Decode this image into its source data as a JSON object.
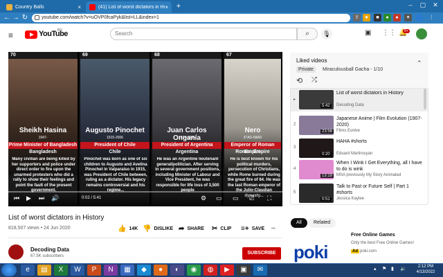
{
  "browser": {
    "tabs": [
      {
        "label": "Country Balls",
        "active": false
      },
      {
        "label": "(41) List of worst dictators in His",
        "active": true
      }
    ],
    "new_tab": "+",
    "url": "youtube.com/watch?v=uOVP0fcaPyk&list=LL&index=1",
    "notif_badge": "9+"
  },
  "youtube": {
    "logo_text": "YouTube",
    "logo_region": "BD",
    "search_placeholder": "Search"
  },
  "video": {
    "cards": [
      {
        "rank": "70",
        "name": "Sheikh Hasina",
        "years": "1947-",
        "title": "Prime Minister of Bangladesh",
        "country": "Bangladesh",
        "desc": "Many civilian are being killed by her supporters and police under direct order to fire upon the unarmed protesters who did a rally to show their feelings and point the fault of the present government."
      },
      {
        "rank": "69",
        "name": "Augusto Pinochet",
        "years": "1915-2006",
        "title": "President of Chile",
        "country": "Chile",
        "desc": "Pinochet was born as one of six children to Augusto and Avelina Pinochet in Valparaiso in 1915, was President of Chile between, ruling as a dictator. His legacy remains controversial and his regime..."
      },
      {
        "rank": "68",
        "name": "Juan Carlos Onganía",
        "years": "1914-1995",
        "title": "President of Argentina",
        "country": "Argentina",
        "desc": "He was an Argentine lieutenant general/politician. After serving in several government positions, including Minister of Labour and Vice President, he was responsible for life loss of 3,500 people"
      },
      {
        "rank": "67",
        "name": "Nero",
        "years": "37AD-68AD",
        "title": "Emperor of Roman Empire",
        "country": "Roman Empire",
        "desc": "He is best known for his political murders, persecution of Christians, while Rome burned during the great fire of 64. He was the last Roman emperor of the Julio-Claudian dynasty..."
      }
    ],
    "time": "0:02 / 5:41",
    "title": "List of worst dictators in History",
    "meta": "818,507 views • 24 Jun 2020",
    "actions": {
      "like": "14K",
      "dislike": "DISLIKE",
      "share": "SHARE",
      "clip": "CLIP",
      "save": "SAVE",
      "more": "..."
    },
    "channel": {
      "name": "Decoding Data",
      "subs": "67.5K subscribers",
      "subscribe": "SUBSCRIBE"
    }
  },
  "playlist": {
    "title": "Liked videos",
    "private": "Private",
    "owner": "Miraculousball Gacha - 1/10",
    "items": [
      {
        "index": "▸",
        "title": "List of worst dictators in History",
        "channel": "Decoding Data",
        "duration": "5:42",
        "thumb": "#3a3a3a"
      },
      {
        "index": "2",
        "title": "Japanese Anime | Film Evolution (1907-2020)",
        "channel": "Films Evolve",
        "duration": "23:56",
        "thumb": "#8a7a9a"
      },
      {
        "index": "3",
        "title": "HAHA #shorts",
        "channel": "Eduard Martirosyan",
        "duration": "0:20",
        "thumb": "#201818"
      },
      {
        "index": "4",
        "title": "When I Wink I Get Everything, all I have to do is wink",
        "channel": "MSA previously My Story Animated",
        "duration": "13:19",
        "thumb": "#e08ad0"
      },
      {
        "index": "5",
        "title": "Talk to Past or Future Self | Part 1 #shorts",
        "channel": "Jessica Kaylee",
        "duration": "0:51",
        "thumb": "#2a2a2a"
      }
    ]
  },
  "chips": [
    "All",
    "Related"
  ],
  "ad": {
    "title": "Free Online Games",
    "desc": "Only the best Free Online Games!",
    "badge": "Ad",
    "domain": "poki.com",
    "logo": "poki"
  },
  "taskbar": {
    "time": "2:12 PM",
    "date": "4/13/2022"
  }
}
